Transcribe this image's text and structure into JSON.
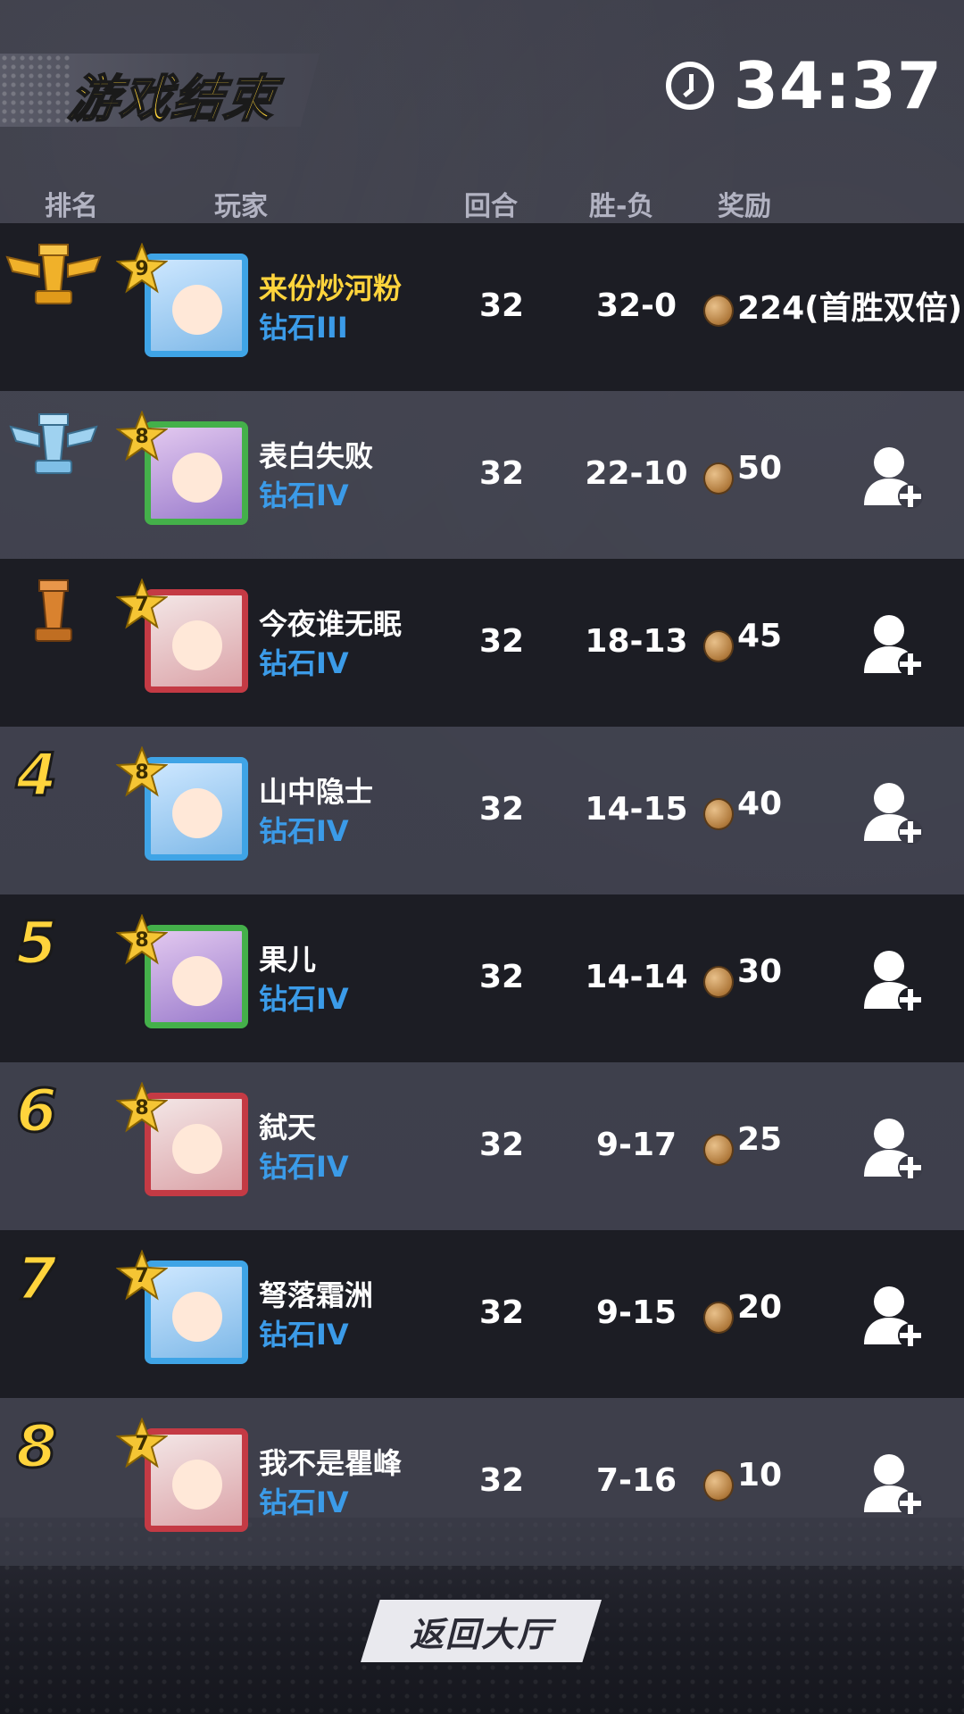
{
  "title": "游戏结束",
  "timer": "34:37",
  "headers": {
    "rank": "排名",
    "player": "玩家",
    "rounds": "回合",
    "win_loss": "胜-负",
    "reward": "奖励"
  },
  "players": [
    {
      "rank": "1",
      "level": "9",
      "name": "来份炒河粉",
      "tier": "钻石III",
      "rounds": "32",
      "win_loss": "32-0",
      "reward": "224(首胜双倍)"
    },
    {
      "rank": "2",
      "level": "8",
      "name": "表白失败",
      "tier": "钻石IV",
      "rounds": "32",
      "win_loss": "22-10",
      "reward": "50"
    },
    {
      "rank": "3",
      "level": "7",
      "name": "今夜谁无眠",
      "tier": "钻石IV",
      "rounds": "32",
      "win_loss": "18-13",
      "reward": "45"
    },
    {
      "rank": "4",
      "level": "8",
      "name": "山中隐士",
      "tier": "钻石IV",
      "rounds": "32",
      "win_loss": "14-15",
      "reward": "40"
    },
    {
      "rank": "5",
      "level": "8",
      "name": "果儿",
      "tier": "钻石IV",
      "rounds": "32",
      "win_loss": "14-14",
      "reward": "30"
    },
    {
      "rank": "6",
      "level": "8",
      "name": "弑天",
      "tier": "钻石IV",
      "rounds": "32",
      "win_loss": "9-17",
      "reward": "25"
    },
    {
      "rank": "7",
      "level": "7",
      "name": "弩落霜洲",
      "tier": "钻石IV",
      "rounds": "32",
      "win_loss": "9-15",
      "reward": "20"
    },
    {
      "rank": "8",
      "level": "7",
      "name": "我不是瞿峰",
      "tier": "钻石IV",
      "rounds": "32",
      "win_loss": "7-16",
      "reward": "10"
    }
  ],
  "return_button": "返回大厅",
  "colors": {
    "gold": "#ffd43c",
    "tier_blue": "#3b9be8",
    "trophy_gold": "#f0b12a",
    "trophy_silver": "#9fd2f0",
    "trophy_bronze": "#d9822f"
  }
}
